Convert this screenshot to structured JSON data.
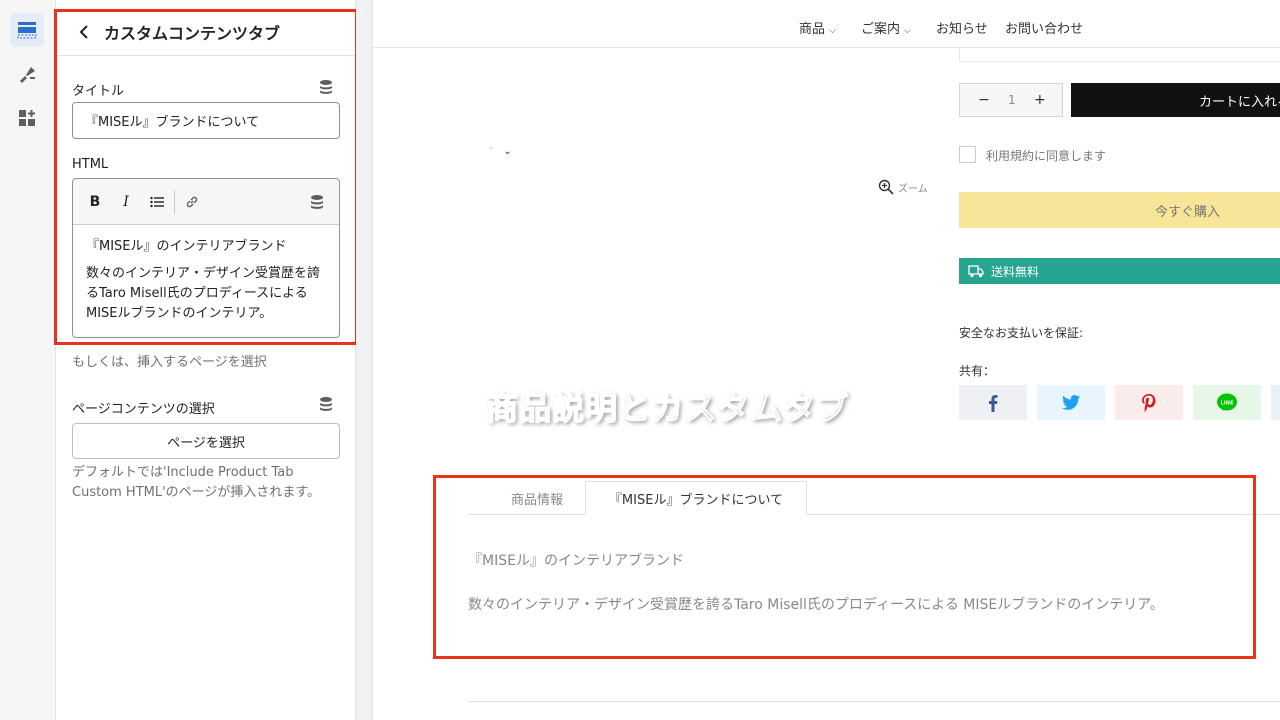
{
  "sidebar": {
    "title": "カスタムコンテンツタブ",
    "title_label": "タイトル",
    "title_value": "『MISEル』ブランドについて",
    "html_label": "HTML",
    "toolbar": {
      "bold": "B",
      "italic": "I"
    },
    "editor_heading": "『MISEル』のインテリアブランド",
    "editor_paragraph": "数々のインテリア・デザイン受賞歴を誇るTaro Misell氏のプロディースによる MISEルブランドのインテリア。",
    "or_text": "もしくは、挿入するページを選択",
    "page_content_label": "ページコンテンツの選択",
    "select_page_button": "ページを選択",
    "default_help": "デフォルトでは'Include Product Tab Custom HTML'のページが挿入されます。"
  },
  "store": {
    "nav": [
      "商品",
      "ご案内",
      "お知らせ",
      "お問い合わせ"
    ],
    "qty_minus": "−",
    "qty_value": "1",
    "qty_plus": "+",
    "add_to_cart": "カートに入れる",
    "agree": "利用規約に同意します",
    "buy_now": "今すぐ購入",
    "free_shipping": "送料無料",
    "secure_payment": "安全なお支払いを保証:",
    "share_label": "共有：",
    "zoom": "ズーム",
    "annotation": "商品説明とカスタムタブ",
    "tabs": [
      "商品情報",
      "『MISEル』ブランドについて"
    ],
    "tab_content_title": "『MISEル』のインテリアブランド",
    "tab_content_desc": "数々のインテリア・デザイン受賞歴を誇るTaro Misell氏のプロディースによる MISEルブランドのインテリア。"
  },
  "colors": {
    "highlight": "#e8321b",
    "shipping_bar": "#27a592",
    "buy_button": "#f7e69a",
    "facebook": "#3b5998",
    "twitter": "#1da1f2",
    "pinterest": "#cb2027",
    "line": "#00c300"
  }
}
